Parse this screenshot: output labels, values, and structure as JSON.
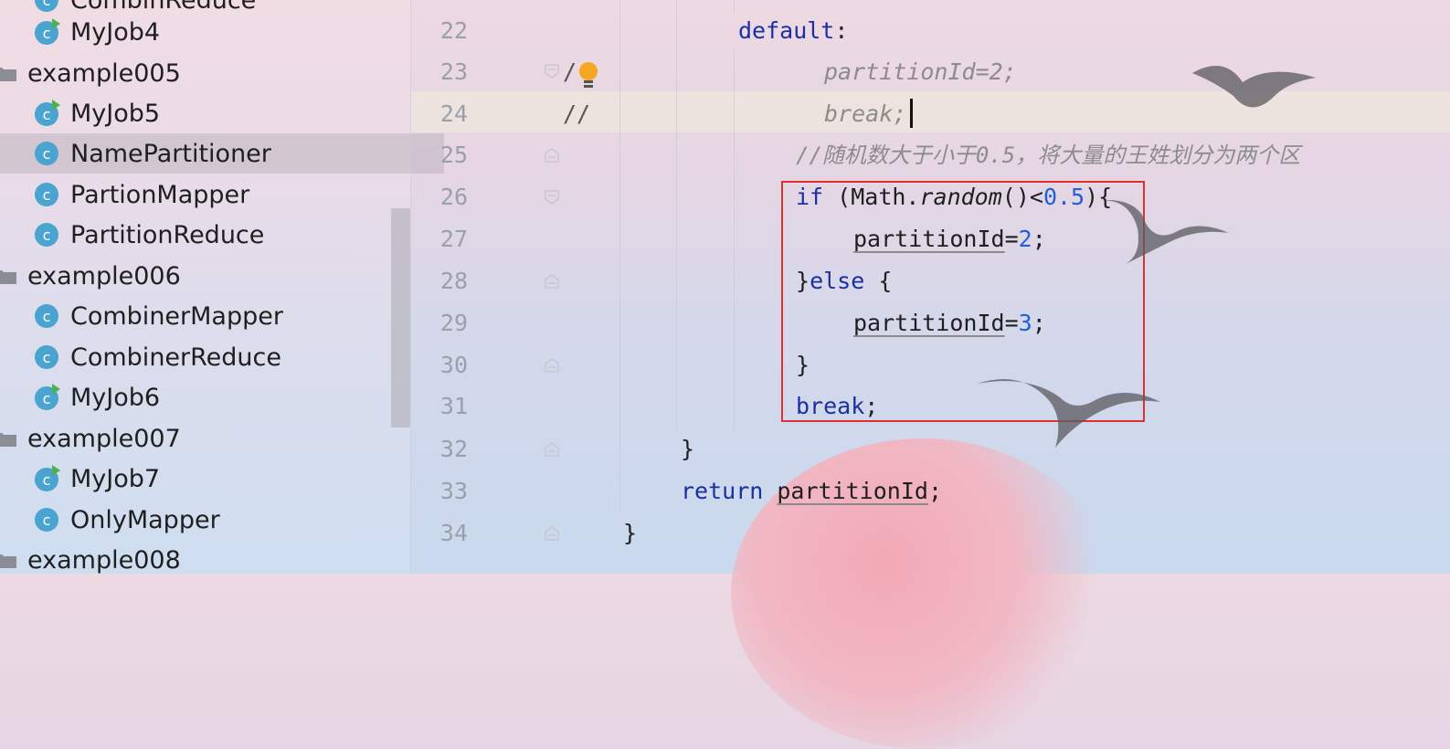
{
  "sidebar": {
    "top_partial_label": "CombinReduce",
    "items": [
      {
        "label": "MyJob4",
        "kind": "runnable"
      },
      {
        "label": "example005",
        "kind": "folder"
      },
      {
        "label": "MyJob5",
        "kind": "runnable"
      },
      {
        "label": "NamePartitioner",
        "kind": "class",
        "selected": true
      },
      {
        "label": "PartionMapper",
        "kind": "class"
      },
      {
        "label": "PartitionReduce",
        "kind": "class"
      },
      {
        "label": "example006",
        "kind": "folder"
      },
      {
        "label": "CombinerMapper",
        "kind": "class"
      },
      {
        "label": "CombinerReduce",
        "kind": "class"
      },
      {
        "label": "MyJob6",
        "kind": "runnable"
      },
      {
        "label": "example007",
        "kind": "folder"
      },
      {
        "label": "MyJob7",
        "kind": "runnable"
      },
      {
        "label": "OnlyMapper",
        "kind": "class"
      },
      {
        "label": "example008",
        "kind": "folder"
      }
    ]
  },
  "editor": {
    "line_numbers": [
      "22",
      "23",
      "24",
      "25",
      "26",
      "27",
      "28",
      "29",
      "30",
      "31",
      "32",
      "33",
      "34"
    ],
    "code": {
      "l22": {
        "kw": "default",
        "rest": ":"
      },
      "l23": {
        "text": "partitionId=2;"
      },
      "l24": {
        "text": "break;"
      },
      "l25": {
        "text": "//随机数大于小于0.5，将大量的王姓划分为两个区"
      },
      "l26": {
        "kw": "if",
        "open": " (Math.",
        "method": "random",
        "mid": "()<",
        "num": "0.5",
        "close": "){"
      },
      "l27": {
        "var": "partitionId",
        "eq": "=",
        "num": "2",
        "semi": ";"
      },
      "l28": {
        "brace": "}",
        "kw": "else",
        "rest": " {"
      },
      "l29": {
        "var": "partitionId",
        "eq": "=",
        "num": "3",
        "semi": ";"
      },
      "l30": {
        "text": "}"
      },
      "l31": {
        "kw": "break",
        "semi": ";"
      },
      "l32": {
        "text": "}"
      },
      "l33": {
        "kw": "return",
        "var": "partitionId",
        "semi": ";"
      },
      "l34": {
        "text": "}"
      }
    },
    "comment_markers": {
      "l23": "/",
      "l24": "//"
    },
    "colors": {
      "keyword": "#1a2fa0",
      "number": "#1f5fd8",
      "comment": "#8c8c8c",
      "highlight_box": "#e03030"
    }
  },
  "icons": {
    "class": "class-icon",
    "runnable": "run-class-icon",
    "folder": "package-folder-icon",
    "intention": "lightbulb-icon"
  }
}
